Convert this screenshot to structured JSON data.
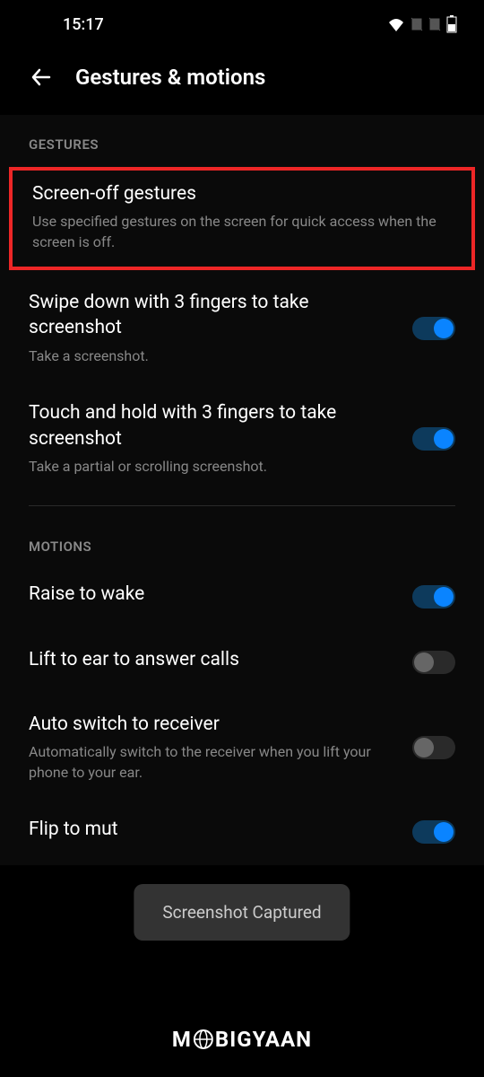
{
  "status_bar": {
    "time": "15:17"
  },
  "header": {
    "title": "Gestures & motions"
  },
  "sections": {
    "gestures": {
      "label": "GESTURES",
      "items": [
        {
          "title": "Screen-off gestures",
          "subtitle": "Use specified gestures on the screen for quick access when the screen is off."
        },
        {
          "title": "Swipe down with 3 fingers to take screenshot",
          "subtitle": "Take a screenshot."
        },
        {
          "title": "Touch and hold with 3 fingers to take screenshot",
          "subtitle": "Take a partial or scrolling screenshot."
        }
      ]
    },
    "motions": {
      "label": "MOTIONS",
      "items": [
        {
          "title": "Raise to wake"
        },
        {
          "title": "Lift to ear to answer calls"
        },
        {
          "title": "Auto switch to receiver",
          "subtitle": "Automatically switch to the receiver when you lift your phone to your ear."
        },
        {
          "title": "Flip to mut"
        }
      ]
    }
  },
  "toast": {
    "message": "Screenshot Captured"
  },
  "watermark": {
    "prefix": "M",
    "suffix": "BIGYAAN"
  },
  "toggles": {
    "swipe_screenshot": true,
    "touch_hold_screenshot": true,
    "raise_to_wake": true,
    "lift_to_ear": false,
    "auto_switch_receiver": false,
    "flip_to_mute": true
  },
  "colors": {
    "highlight": "#ed2626",
    "toggle_on": "#0a84ff",
    "toggle_track_on": "#0d3a5c",
    "background": "#000000"
  }
}
